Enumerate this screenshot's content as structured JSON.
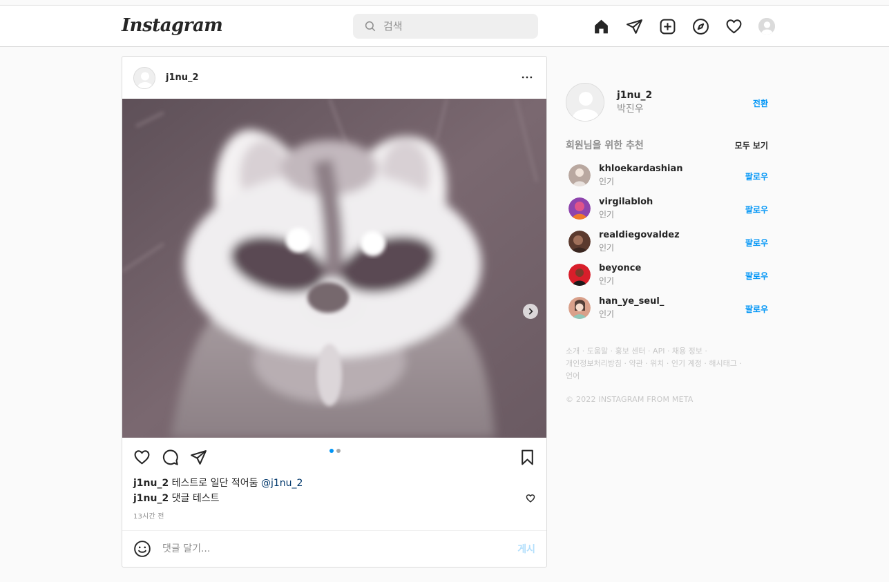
{
  "nav": {
    "logo": "Instagram",
    "search_placeholder": "검색"
  },
  "post": {
    "username": "j1nu_2",
    "caption_user": "j1nu_2",
    "caption_text": "테스트로 일단 적어둠",
    "caption_mention": "@j1nu_2",
    "comment_user": "j1nu_2",
    "comment_text": "댓글 테스트",
    "time": "13시간 전",
    "comment_placeholder": "댓글 달기...",
    "post_button": "게시",
    "carousel": {
      "current": 1,
      "total": 2
    }
  },
  "sidebar": {
    "username": "j1nu_2",
    "name": "박진우",
    "switch_label": "전환",
    "suggestions_title": "회원님을 위한 추천",
    "see_all": "모두 보기",
    "suggestions": [
      {
        "username": "khloekardashian",
        "sub": "인기",
        "follow": "팔로우",
        "color": "#b9a8a0"
      },
      {
        "username": "virgilabloh",
        "sub": "인기",
        "follow": "팔로우",
        "color": "#8e44ad"
      },
      {
        "username": "realdiegovaldez",
        "sub": "인기",
        "follow": "팔로우",
        "color": "#5b3a2e"
      },
      {
        "username": "beyonce",
        "sub": "인기",
        "follow": "팔로우",
        "color": "#d81e2a"
      },
      {
        "username": "han_ye_seul_",
        "sub": "인기",
        "follow": "팔로우",
        "color": "#d9a08a"
      }
    ],
    "footer_line1": "소개 · 도움말 · 홍보 센터 · API · 채용 정보 ·",
    "footer_line2": "개인정보처리방침 · 약관 · 위치 · 인기 계정 · 해시태그 ·",
    "footer_line3": "언어",
    "copyright": "© 2022 INSTAGRAM FROM META"
  }
}
